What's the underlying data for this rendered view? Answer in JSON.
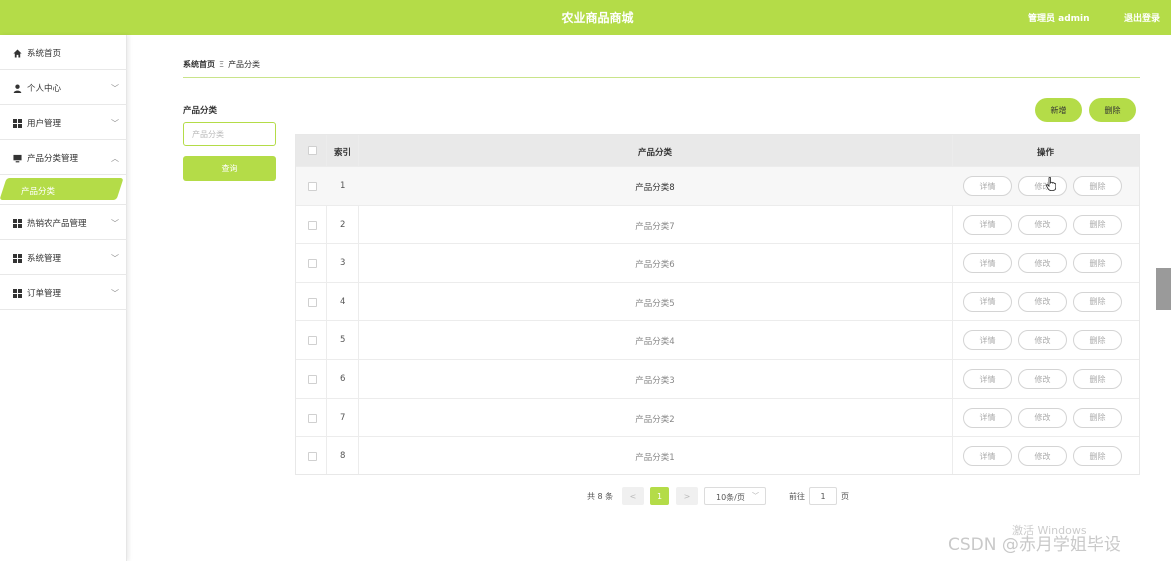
{
  "header": {
    "title": "农业商品商城",
    "user": "管理员 admin",
    "logout": "退出登录"
  },
  "sidebar": {
    "items": [
      {
        "label": "系统首页",
        "icon": "home-icon",
        "expandable": false
      },
      {
        "label": "个人中心",
        "icon": "person-icon",
        "expandable": true
      },
      {
        "label": "用户管理",
        "icon": "grid-icon",
        "expandable": true
      },
      {
        "label": "产品分类管理",
        "icon": "monitor-icon",
        "expandable": true,
        "expanded": true
      },
      {
        "label": "热销农产品管理",
        "icon": "grid-icon",
        "expandable": true
      },
      {
        "label": "系统管理",
        "icon": "grid-icon",
        "expandable": true
      },
      {
        "label": "订单管理",
        "icon": "grid-icon",
        "expandable": true
      }
    ],
    "active_sub": "产品分类"
  },
  "breadcrumb": {
    "home": "系统首页",
    "separator": "Ξ",
    "current": "产品分类"
  },
  "filter": {
    "label": "产品分类",
    "placeholder": "产品分类",
    "query_label": "查询"
  },
  "actions": {
    "add_label": "新增",
    "delete_label": "删除"
  },
  "table": {
    "headers": {
      "index": "索引",
      "name": "产品分类",
      "ops": "操作"
    },
    "ops": {
      "detail": "详情",
      "edit": "修改",
      "delete": "删除"
    },
    "rows": [
      {
        "index": "1",
        "name": "产品分类8"
      },
      {
        "index": "2",
        "name": "产品分类7"
      },
      {
        "index": "3",
        "name": "产品分类6"
      },
      {
        "index": "4",
        "name": "产品分类5"
      },
      {
        "index": "5",
        "name": "产品分类4"
      },
      {
        "index": "6",
        "name": "产品分类3"
      },
      {
        "index": "7",
        "name": "产品分类2"
      },
      {
        "index": "8",
        "name": "产品分类1"
      }
    ]
  },
  "pagination": {
    "total": "共 8 条",
    "prev": "<",
    "current": "1",
    "next": ">",
    "page_size": "10条/页",
    "goto": "前往",
    "goto_value": "1",
    "page_unit": "页"
  },
  "watermark": {
    "activate": "激活 Windows",
    "csdn": "CSDN @赤月学姐毕设"
  },
  "colors": {
    "accent": "#b4dc48"
  }
}
